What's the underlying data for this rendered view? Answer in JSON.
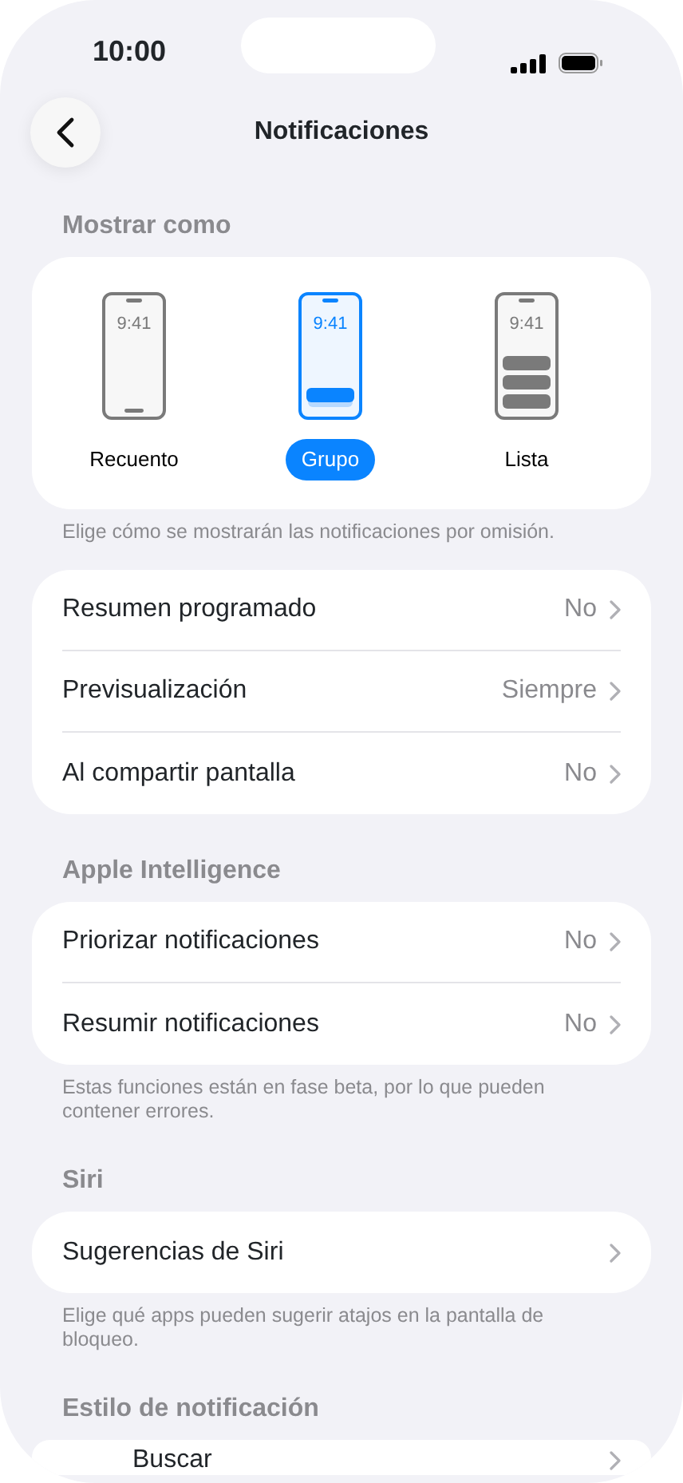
{
  "status_bar": {
    "time": "10:00"
  },
  "nav": {
    "title": "Notificaciones"
  },
  "sections": [
    {
      "kind": "styles",
      "header": "Mostrar como",
      "options": [
        {
          "label": "Recuento",
          "selected": false,
          "kind": "count",
          "clock": "9:41"
        },
        {
          "label": "Grupo",
          "selected": true,
          "kind": "stack",
          "clock": "9:41"
        },
        {
          "label": "Lista",
          "selected": false,
          "kind": "list",
          "clock": "9:41"
        }
      ],
      "footer": "Elige cómo se mostrarán las notificaciones por omisión."
    },
    {
      "kind": "rows",
      "rows": [
        {
          "label": "Resumen programado",
          "value": "No"
        },
        {
          "label": "Previsualización",
          "value": "Siempre"
        },
        {
          "label": "Al compartir pantalla",
          "value": "No"
        }
      ]
    },
    {
      "kind": "rows",
      "header": "Apple Intelligence",
      "rows": [
        {
          "label": "Priorizar notificaciones",
          "value": "No"
        },
        {
          "label": "Resumir notificaciones",
          "value": "No"
        }
      ],
      "footer": "Estas funciones están en fase beta, por lo que pueden contener errores."
    },
    {
      "kind": "rows",
      "header": "Siri",
      "rows": [
        {
          "label": "Sugerencias de Siri"
        }
      ],
      "footer": "Elige qué apps pueden sugerir atajos en la pantalla de bloqueo."
    },
    {
      "kind": "rows",
      "header": "Estilo de notificación",
      "rows": [
        {
          "label": "Buscar"
        }
      ]
    }
  ]
}
